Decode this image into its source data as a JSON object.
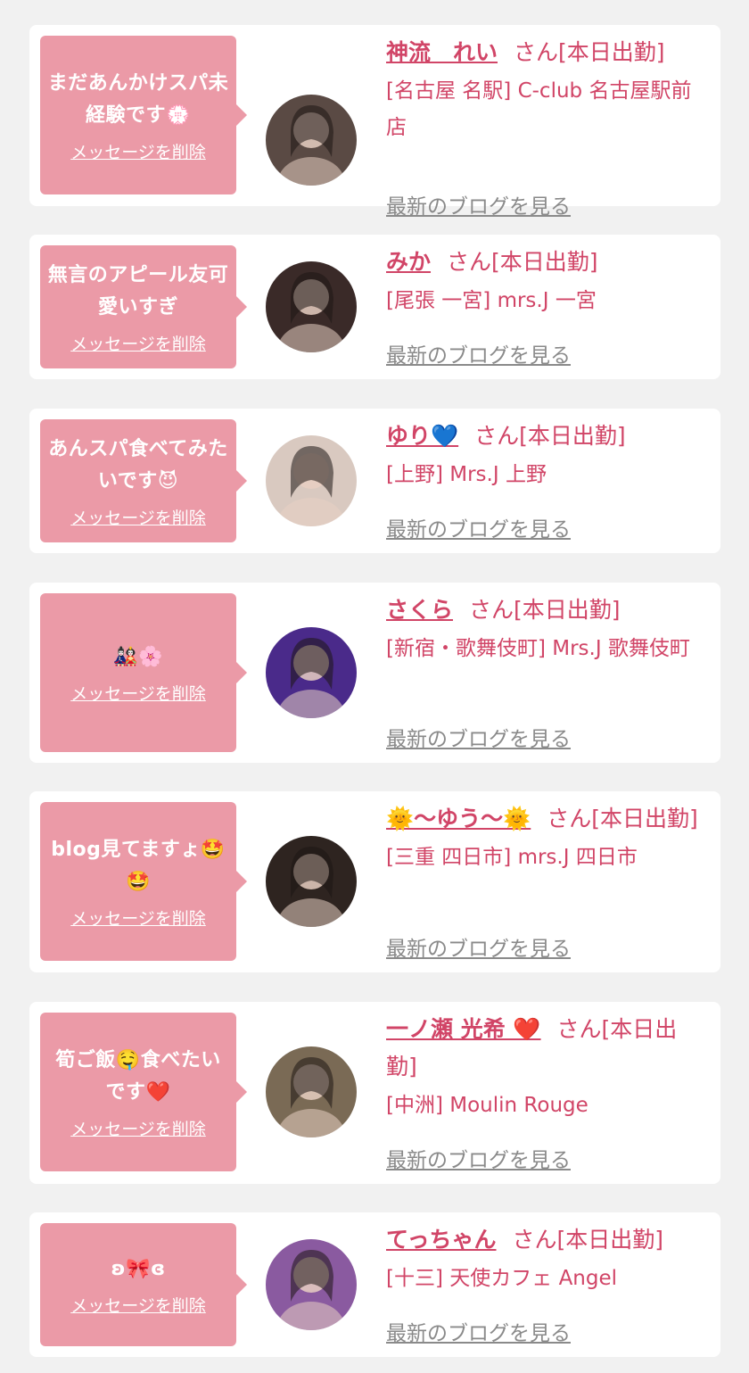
{
  "delete_label": "メッセージを削除",
  "blog_label": "最新のブログを見る",
  "cards": [
    {
      "message": "まだあんかけスパ未経験です💮",
      "name": "神流　れい",
      "suffix": "さん[本日出勤]",
      "shop": "[名古屋 名駅] C-club 名古屋駅前店",
      "avatar_color": "#5a4a44"
    },
    {
      "message": "無言のアピール友可愛いすぎ",
      "name": "みか",
      "suffix": "さん[本日出勤]",
      "shop": "[尾張 一宮] mrs.J 一宮",
      "avatar_color": "#3a2a28"
    },
    {
      "message": "あんスパ食べてみたいです😈",
      "name": "ゆり💙",
      "suffix": "さん[本日出勤]",
      "shop": "[上野] Mrs.J 上野",
      "avatar_color": "#d9c9c0"
    },
    {
      "message": "🎎🌸",
      "name": "さくら",
      "suffix": "さん[本日出勤]",
      "shop": "[新宿・歌舞伎町] Mrs.J 歌舞伎町",
      "avatar_color": "#4a2a8a"
    },
    {
      "message": "blog見てますょ🤩🤩",
      "name": "🌞〜ゆう〜🌞",
      "suffix": "さん[本日出勤]",
      "shop": "[三重 四日市] mrs.J 四日市",
      "avatar_color": "#2e2420"
    },
    {
      "message": "筍ご飯🤤食べたいです❤️",
      "name": "一ノ瀬 光希 ❤️",
      "suffix": "さん[本日出勤]",
      "shop": "[中洲] Moulin Rouge",
      "avatar_color": "#7a6a55"
    },
    {
      "message": "ʚ🎀ɞ",
      "name": "てっちゃん",
      "suffix": "さん[本日出勤]",
      "shop": "[十三] 天使カフェ Angel",
      "avatar_color": "#8a5aa0"
    }
  ]
}
